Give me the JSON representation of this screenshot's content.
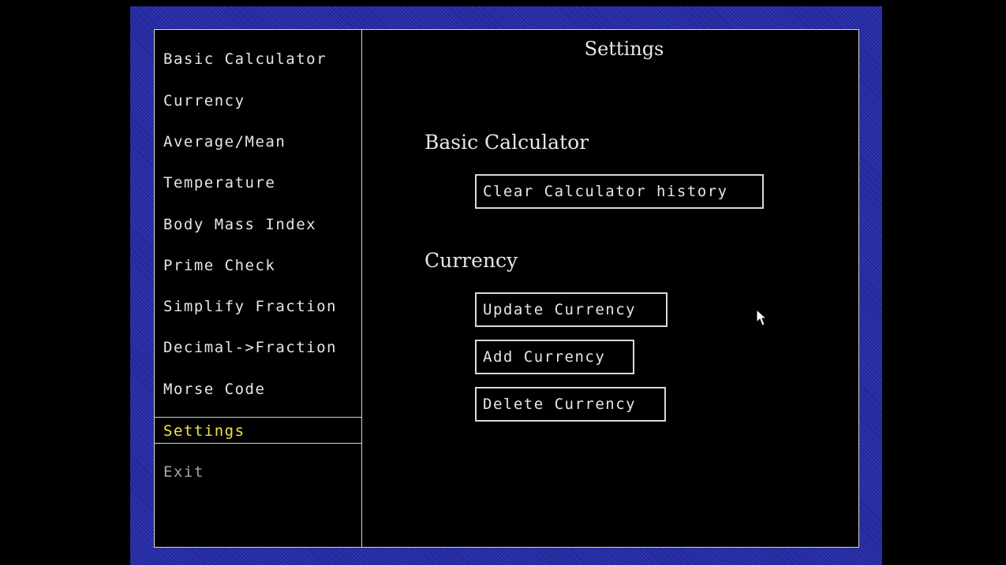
{
  "sidebar": {
    "items": [
      {
        "label": "Basic Calculator"
      },
      {
        "label": "Currency"
      },
      {
        "label": "Average/Mean"
      },
      {
        "label": "Temperature"
      },
      {
        "label": "Body Mass Index"
      },
      {
        "label": "Prime Check"
      },
      {
        "label": "Simplify Fraction"
      },
      {
        "label": "Decimal->Fraction"
      },
      {
        "label": "Morse Code"
      },
      {
        "label": "Settings",
        "selected": true
      },
      {
        "label": "Exit"
      }
    ]
  },
  "main": {
    "title": "Settings",
    "sections": [
      {
        "heading": "Basic Calculator",
        "buttons": [
          {
            "label": "Clear Calculator history"
          }
        ]
      },
      {
        "heading": "Currency",
        "buttons": [
          {
            "label": "Update Currency"
          },
          {
            "label": "Add Currency"
          },
          {
            "label": "Delete Currency"
          }
        ]
      }
    ]
  },
  "icons": {
    "cursor": "mouse-pointer-icon"
  },
  "colors": {
    "background": "#000000",
    "frame": "#2a2fa8",
    "text": "#e6e6e6",
    "selected_text": "#f2e44a",
    "border": "#d8d8d8"
  }
}
